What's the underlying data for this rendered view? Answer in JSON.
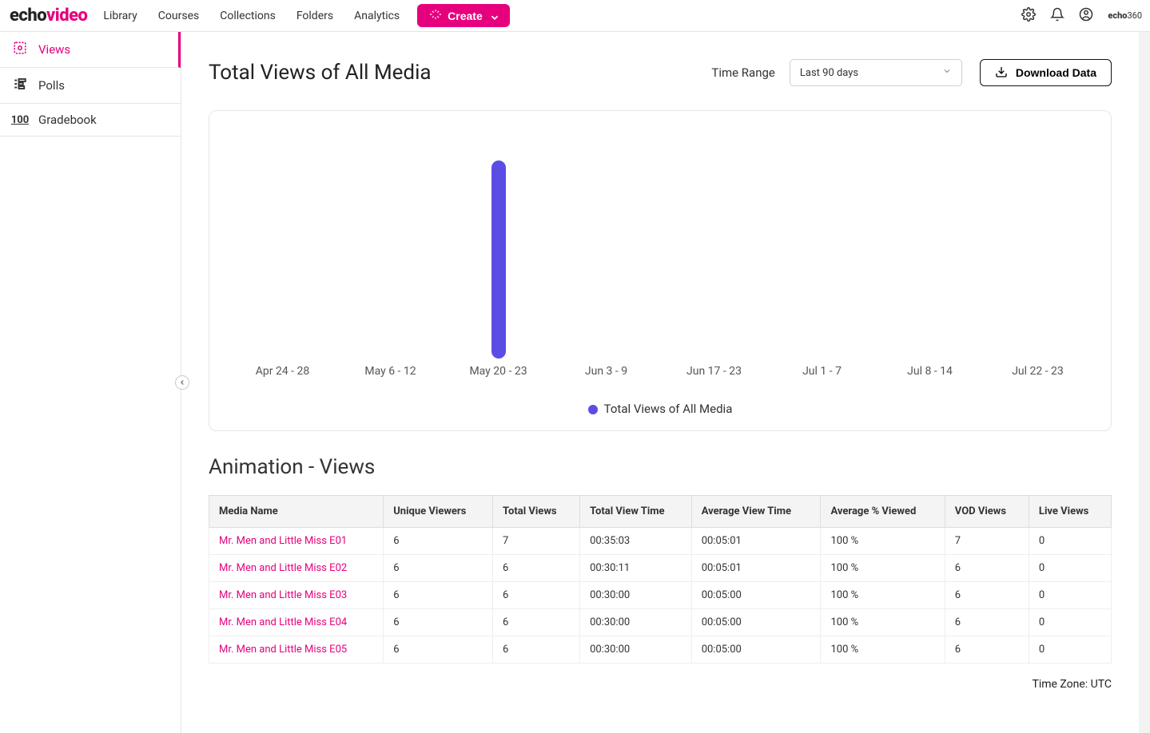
{
  "brand": {
    "echo": "echo",
    "video": "video"
  },
  "nav": {
    "items": [
      {
        "label": "Library"
      },
      {
        "label": "Courses"
      },
      {
        "label": "Collections"
      },
      {
        "label": "Folders"
      },
      {
        "label": "Analytics"
      }
    ],
    "create_label": "Create",
    "echo360_bold": "echo",
    "echo360_light": "360"
  },
  "sidebar": {
    "items": [
      {
        "label": "Views",
        "active": true
      },
      {
        "label": "Polls",
        "active": false
      },
      {
        "label": "Gradebook",
        "active": false
      }
    ]
  },
  "page": {
    "title": "Total Views of All Media",
    "time_range_label": "Time Range",
    "time_range_selected": "Last 90 days",
    "download_label": "Download Data"
  },
  "chart_data": {
    "type": "bar",
    "categories": [
      "Apr 24 - 28",
      "May 6 - 12",
      "May 20 - 23",
      "Jun 3 - 9",
      "Jun 17 - 23",
      "Jul 1 - 7",
      "Jul 8 - 14",
      "Jul 22 - 23"
    ],
    "values": [
      0,
      0,
      31,
      0,
      0,
      0,
      0,
      0
    ],
    "title": "Total Views of All Media",
    "xlabel": "",
    "ylabel": "",
    "ylim": [
      0,
      35
    ],
    "legend": "Total Views of All Media",
    "series_color": "#5b4de4"
  },
  "section": {
    "title": "Animation - Views"
  },
  "table": {
    "headers": [
      "Media Name",
      "Unique Viewers",
      "Total Views",
      "Total View Time",
      "Average View Time",
      "Average % Viewed",
      "VOD Views",
      "Live Views"
    ],
    "rows": [
      {
        "media_name": "Mr. Men and Little Miss E01",
        "unique_viewers": "6",
        "total_views": "7",
        "total_view_time": "00:35:03",
        "avg_view_time": "00:05:01",
        "avg_pct": "100 %",
        "vod": "7",
        "live": "0"
      },
      {
        "media_name": "Mr. Men and Little Miss E02",
        "unique_viewers": "6",
        "total_views": "6",
        "total_view_time": "00:30:11",
        "avg_view_time": "00:05:01",
        "avg_pct": "100 %",
        "vod": "6",
        "live": "0"
      },
      {
        "media_name": "Mr. Men and Little Miss E03",
        "unique_viewers": "6",
        "total_views": "6",
        "total_view_time": "00:30:00",
        "avg_view_time": "00:05:00",
        "avg_pct": "100 %",
        "vod": "6",
        "live": "0"
      },
      {
        "media_name": "Mr. Men and Little Miss E04",
        "unique_viewers": "6",
        "total_views": "6",
        "total_view_time": "00:30:00",
        "avg_view_time": "00:05:00",
        "avg_pct": "100 %",
        "vod": "6",
        "live": "0"
      },
      {
        "media_name": "Mr. Men and Little Miss E05",
        "unique_viewers": "6",
        "total_views": "6",
        "total_view_time": "00:30:00",
        "avg_view_time": "00:05:00",
        "avg_pct": "100 %",
        "vod": "6",
        "live": "0"
      }
    ]
  },
  "timezone": "Time Zone: UTC"
}
